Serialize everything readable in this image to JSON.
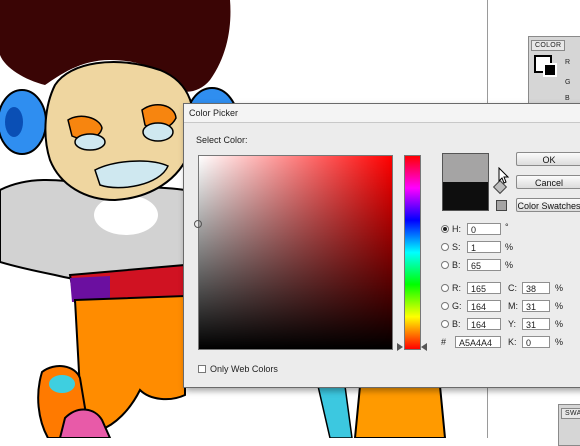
{
  "panels": {
    "color_tab": "COLOR",
    "color_rows": [
      "R",
      "G",
      "B"
    ],
    "swatches_tab": "SWA"
  },
  "dialog": {
    "title": "Color Picker",
    "select_color_label": "Select Color:",
    "ok_label": "OK",
    "cancel_label": "Cancel",
    "swatches_label": "Color Swatches",
    "only_web_colors_label": "Only Web Colors",
    "current_color": "#a5a4a4",
    "original_color": "#0e0e0e",
    "hsb": [
      {
        "label": "H:",
        "value": "0",
        "unit": "°",
        "selected": true
      },
      {
        "label": "S:",
        "value": "1",
        "unit": "%",
        "selected": false
      },
      {
        "label": "B:",
        "value": "65",
        "unit": "%",
        "selected": false
      }
    ],
    "rgb": [
      {
        "label": "R:",
        "value": "165"
      },
      {
        "label": "G:",
        "value": "164"
      },
      {
        "label": "B:",
        "value": "164"
      }
    ],
    "cmyk": [
      {
        "label": "C:",
        "value": "38",
        "unit": "%"
      },
      {
        "label": "M:",
        "value": "31",
        "unit": "%"
      },
      {
        "label": "Y:",
        "value": "31",
        "unit": "%"
      },
      {
        "label": "K:",
        "value": "0",
        "unit": "%"
      }
    ],
    "hex_symbol": "#",
    "hex_value": "A5A4A4"
  }
}
